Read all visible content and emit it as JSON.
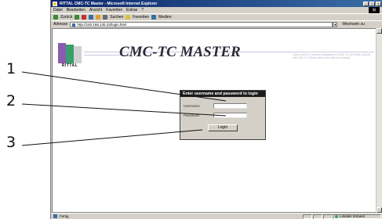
{
  "window": {
    "title": "RITTAL CMC-TC Master - Microsoft Internet Explorer",
    "controls": [
      "_",
      "□",
      "x"
    ]
  },
  "menubar": {
    "items": [
      "Datei",
      "Bearbeiten",
      "Ansicht",
      "Favoriten",
      "Extras",
      "?"
    ]
  },
  "toolbar": {
    "back_label": "Zurück",
    "search_label": "Suchen",
    "favorites_label": "Favoriten",
    "media_label": "Medien"
  },
  "addressbar": {
    "label": "Adresse",
    "url": "http://192.168.135.33/login.html",
    "go_label": "Wechseln zu"
  },
  "header": {
    "brand": "RITTAL",
    "app_title": "CMC-TC MASTER",
    "note": "Lorem ipsum for network-management of CMC-TC and Rittal products with CMC-TC. Please refer to the manual for details."
  },
  "login": {
    "heading": "Enter username and password to login",
    "username_label": "Username",
    "username_value": "",
    "password_label": "Password",
    "password_value": "",
    "submit_label": "Login"
  },
  "statusbar": {
    "status_text": "Fertig",
    "zone_text": "Lokales Intranet"
  },
  "callouts": [
    "1",
    "2",
    "3"
  ]
}
